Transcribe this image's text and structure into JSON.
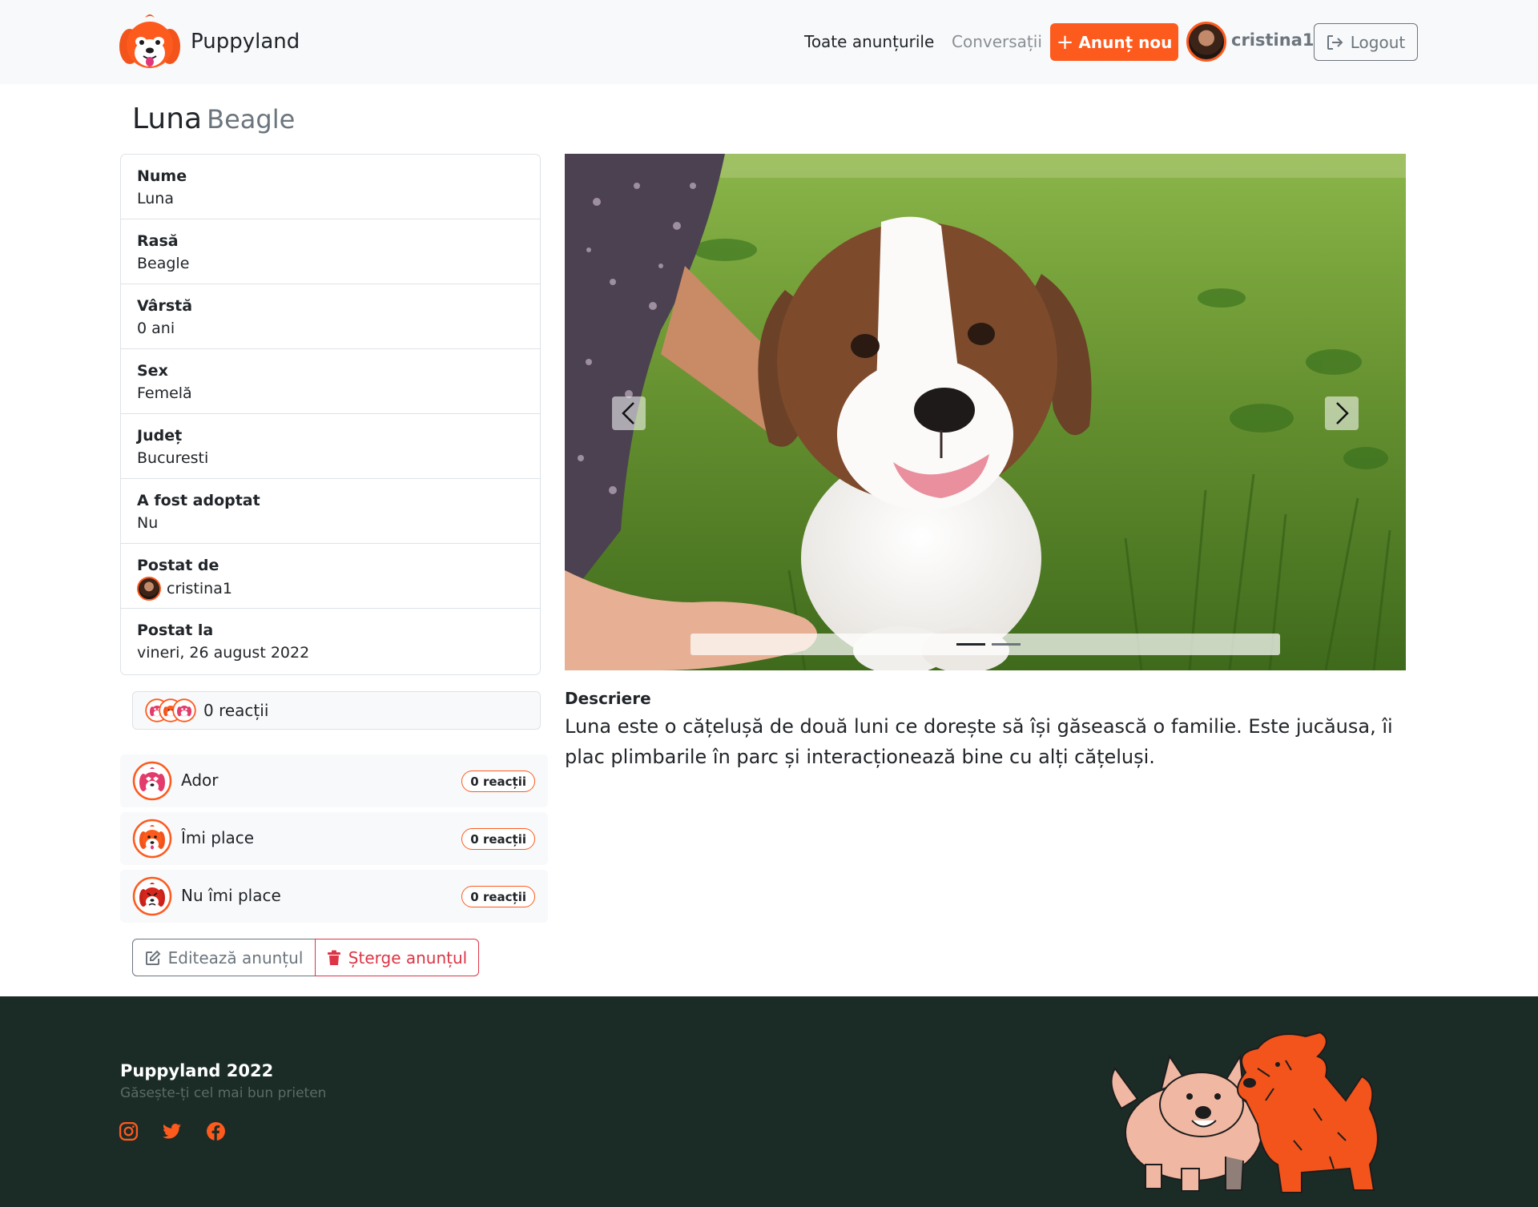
{
  "nav": {
    "brand": "Puppyland",
    "all_ads": "Toate anunțurile",
    "conversations": "Conversații",
    "new_ad": "Anunț nou",
    "username": "cristina1",
    "logout": "Logout"
  },
  "title": {
    "name": "Luna",
    "breed": "Beagle"
  },
  "info": [
    {
      "label": "Nume",
      "value": "Luna"
    },
    {
      "label": "Rasă",
      "value": "Beagle"
    },
    {
      "label": "Vârstă",
      "value": "0 ani"
    },
    {
      "label": "Sex",
      "value": "Femelă"
    },
    {
      "label": "Județ",
      "value": "Bucuresti"
    },
    {
      "label": "A fost adoptat",
      "value": "Nu"
    },
    {
      "label": "Postat de",
      "value": "cristina1"
    },
    {
      "label": "Postat la",
      "value": "vineri, 26 august 2022"
    }
  ],
  "reactions": {
    "summary": "0 reacții",
    "items": [
      {
        "label": "Ador",
        "count": "0 reacții",
        "icon": "love-dog-icon"
      },
      {
        "label": "Îmi place",
        "count": "0 reacții",
        "icon": "like-dog-icon"
      },
      {
        "label": "Nu îmi place",
        "count": "0 reacții",
        "icon": "dislike-dog-icon"
      }
    ]
  },
  "actions": {
    "edit": "Editează anunțul",
    "delete": "Șterge anunțul"
  },
  "description": {
    "title": "Descriere",
    "text": "Luna este o cățelușă de două luni ce dorește să își găsească o familie. Este jucăusa, îi plac plimbarile în parc și interacționează bine cu alți cățeluși."
  },
  "carousel": {
    "slide_count": 2,
    "active_index": 0
  },
  "footer": {
    "title": "Puppyland 2022",
    "subtitle": "Găsește-ți cel mai bun prieten"
  },
  "colors": {
    "accent": "#fd5a1e",
    "footer_bg": "#1b2c26",
    "danger": "#dc3545",
    "muted": "#6c757d"
  }
}
